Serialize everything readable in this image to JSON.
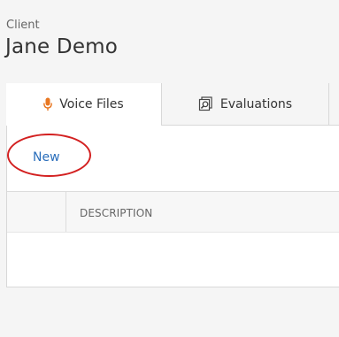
{
  "client": {
    "label": "Client",
    "name": "Jane Demo"
  },
  "tabs": [
    {
      "label": "Voice Files",
      "icon": "microphone-icon",
      "icon_color": "#e87722",
      "active": true
    },
    {
      "label": "Evaluations",
      "icon": "evaluation-search-icon",
      "active": false
    }
  ],
  "toolbar": {
    "new_label": "New"
  },
  "table": {
    "columns": [
      "",
      "DESCRIPTION"
    ]
  },
  "colors": {
    "accent": "#2a6ebb",
    "highlight": "#d32020"
  }
}
